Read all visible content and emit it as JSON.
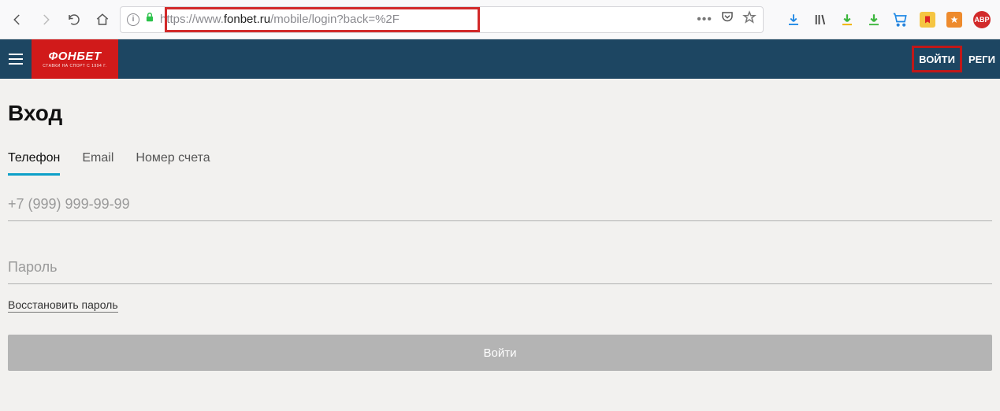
{
  "browser": {
    "url_prefix": "https://www.",
    "url_domain": "fonbet.ru",
    "url_path": "/mobile/login?back=%2F",
    "dots": "•••",
    "abp_label": "ABP"
  },
  "header": {
    "logo_main": "ФОНБЕТ",
    "logo_sub": "СТАВКИ НА СПОРТ С 1994 Г.",
    "login": "ВОЙТИ",
    "register": "РЕГИ"
  },
  "page": {
    "title": "Вход",
    "tabs": {
      "phone": "Телефон",
      "email": "Email",
      "account": "Номер счета"
    },
    "phone_placeholder": "+7 (999) 999-99-99",
    "password_placeholder": "Пароль",
    "recover": "Восстановить пароль",
    "submit": "Войти"
  }
}
